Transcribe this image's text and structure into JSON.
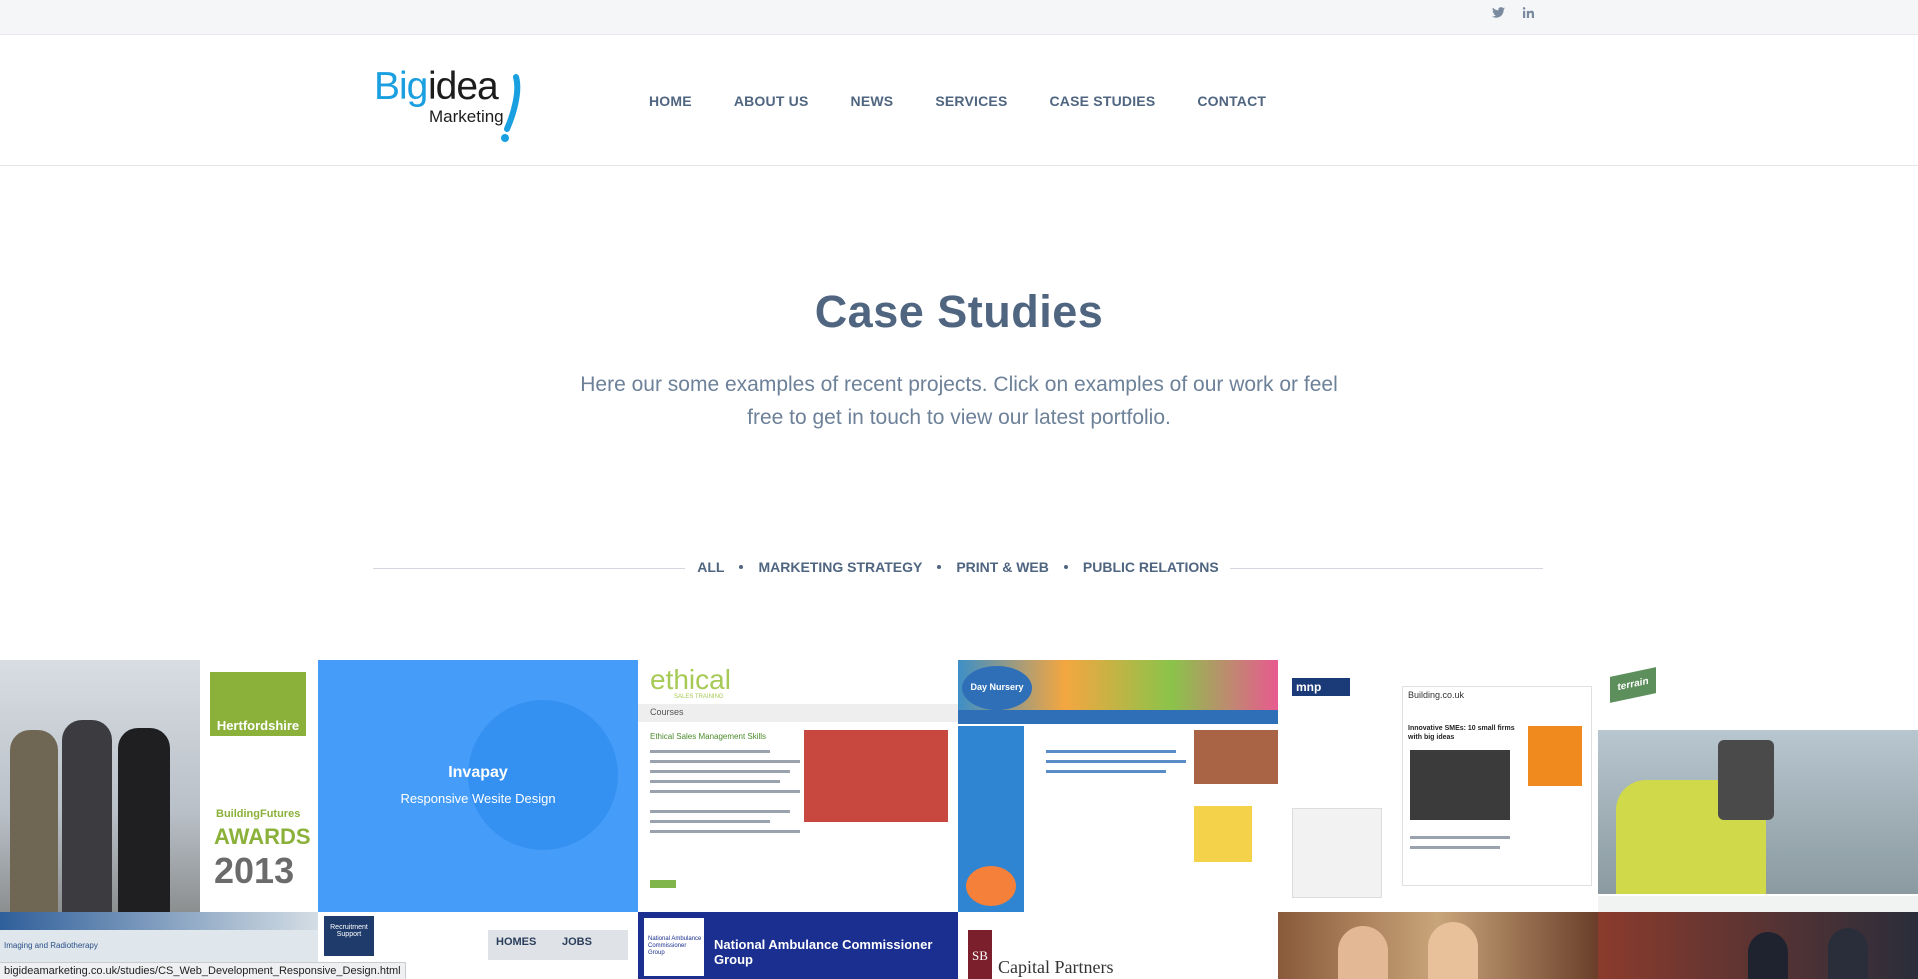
{
  "topbar": {
    "social": [
      "twitter-icon",
      "linkedin-icon"
    ]
  },
  "logo": {
    "big": "Big",
    "idea": "idea",
    "marketing": "Marketing"
  },
  "nav": {
    "items": [
      "HOME",
      "ABOUT US",
      "NEWS",
      "SERVICES",
      "CASE STUDIES",
      "CONTACT"
    ]
  },
  "hero": {
    "title": "Case Studies",
    "subtitle": "Here our some examples of recent projects. Click on examples of our work or feel free to get in touch to view our latest portfolio."
  },
  "filters": [
    "ALL",
    "MARKETING STRATEGY",
    "PRINT & WEB",
    "PUBLIC RELATIONS"
  ],
  "gallery": {
    "hover_tile": {
      "title": "Invapay",
      "subtitle": "Responsive Wesite Design"
    },
    "tile_texts": {
      "hertfordshire": "Hertfordshire",
      "building_futures": "BuildingFutures",
      "awards": "AWARDS",
      "year": "2013",
      "ethical": "ethical",
      "ethical_sub": "SALES TRAINING",
      "courses": "Courses",
      "ethical_heading": "Ethical Sales Management Skills",
      "nursery": "Day Nursery",
      "mnp": "mnp",
      "building_site": "Building.co.uk",
      "building_headline": "Innovative SMEs: 10 small firms with big ideas",
      "terrain": "terrain",
      "imaging": "Imaging and Radiotherapy",
      "recruitment": "Recruitment Support",
      "homes": "HOMES",
      "jobs": "JOBS",
      "nacg_logo": "National Ambulance Commissioner Group",
      "nacg_title": "National Ambulance Commissioner Group",
      "sb": "SB",
      "capital_partners": "Capital Partners"
    }
  },
  "status_url": "bigideamarketing.co.uk/studies/CS_Web_Development_Responsive_Design.html",
  "colors": {
    "accent": "#1a9fe0",
    "text": "#4f6580",
    "overlay": "#3696fa"
  }
}
